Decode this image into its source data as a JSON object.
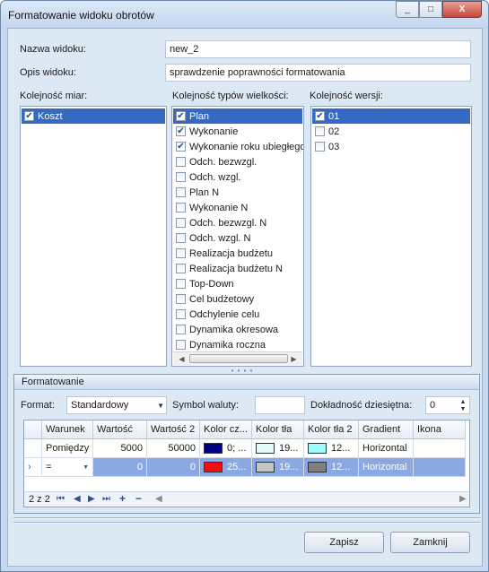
{
  "window": {
    "title": "Formatowanie widoku obrotów",
    "close_glyph": "X",
    "maximize_glyph": "□",
    "minimize_glyph": "_"
  },
  "form": {
    "name_label": "Nazwa widoku:",
    "name_value": "new_2",
    "desc_label": "Opis widoku:",
    "desc_value": "sprawdzenie poprawności formatowania"
  },
  "measures": {
    "label": "Kolejność miar:",
    "items": [
      {
        "label": "Koszt",
        "checked": true,
        "selected": true
      }
    ]
  },
  "value_types": {
    "label": "Kolejność typów wielkości:",
    "items": [
      {
        "label": "Plan",
        "checked": true,
        "selected": true
      },
      {
        "label": "Wykonanie",
        "checked": true,
        "selected": false
      },
      {
        "label": "Wykonanie roku ubiegłego",
        "checked": true,
        "selected": false
      },
      {
        "label": "Odch. bezwzgl.",
        "checked": false,
        "selected": false
      },
      {
        "label": "Odch. wzgl.",
        "checked": false,
        "selected": false
      },
      {
        "label": "Plan N",
        "checked": false,
        "selected": false
      },
      {
        "label": "Wykonanie N",
        "checked": false,
        "selected": false
      },
      {
        "label": "Odch. bezwzgl. N",
        "checked": false,
        "selected": false
      },
      {
        "label": "Odch. wzgl. N",
        "checked": false,
        "selected": false
      },
      {
        "label": "Realizacja budżetu",
        "checked": false,
        "selected": false
      },
      {
        "label": "Realizacja budżetu N",
        "checked": false,
        "selected": false
      },
      {
        "label": "Top-Down",
        "checked": false,
        "selected": false
      },
      {
        "label": "Cel budżetowy",
        "checked": false,
        "selected": false
      },
      {
        "label": "Odchylenie celu",
        "checked": false,
        "selected": false
      },
      {
        "label": "Dynamika okresowa",
        "checked": false,
        "selected": false
      },
      {
        "label": "Dynamika roczna",
        "checked": false,
        "selected": false
      }
    ]
  },
  "versions": {
    "label": "Kolejność wersji:",
    "items": [
      {
        "label": "01",
        "checked": true,
        "selected": true
      },
      {
        "label": "02",
        "checked": false,
        "selected": false
      },
      {
        "label": "03",
        "checked": false,
        "selected": false
      }
    ]
  },
  "formatting": {
    "title": "Formatowanie",
    "format_label": "Format:",
    "format_value": "Standardowy",
    "currency_label": "Symbol waluty:",
    "currency_value": "",
    "precision_label": "Dokładność dziesiętna:",
    "precision_value": "0",
    "columns": [
      "Warunek",
      "Wartość",
      "Wartość 2",
      "Kolor cz...",
      "Kolor tła",
      "Kolor tła 2",
      "Gradient",
      "Ikona"
    ],
    "rows": [
      {
        "warunek": "Pomiędzy",
        "wartosc": "5000",
        "wartosc2": "50000",
        "kolor_czcionki": "0; ...",
        "kolor_czcionki_hex": "#000080",
        "kolor_tla": "19...",
        "kolor_tla_hex": "#e2fcfc",
        "kolor_tla2": "12...",
        "kolor_tla2_hex": "#9ffcfc",
        "gradient": "Horizontal",
        "ikona": ""
      },
      {
        "warunek": "=",
        "wartosc": "0",
        "wartosc2": "0",
        "kolor_czcionki": "25...",
        "kolor_czcionki_hex": "#ef1010",
        "kolor_tla": "19...",
        "kolor_tla_hex": "#c4c4c4",
        "kolor_tla2": "12...",
        "kolor_tla2_hex": "#808080",
        "gradient": "Horizontal",
        "ikona": ""
      }
    ],
    "pager": "2 z 2"
  },
  "buttons": {
    "save": "Zapisz",
    "close": "Zamknij"
  },
  "colors": {
    "selection": "#3669c2",
    "selected_row": "#8aa8e1",
    "window_bg": "#dde8f5"
  }
}
